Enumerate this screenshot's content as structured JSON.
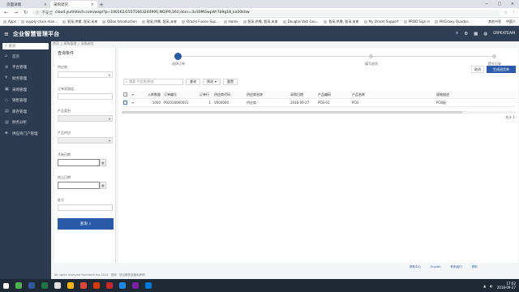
{
  "browser": {
    "tabs": [
      {
        "label": "页面详情",
        "active": false
      },
      {
        "label": "采购退货",
        "active": true
      }
    ],
    "address": "cloud.yunhitech.com/wap/?p=100162/15571663244991;NO/P0,162;docs=3v30MGwpW!7b9g18_ka30ktiw",
    "secure_label": "不安全",
    "bookmarks": [
      "Apps",
      "supply chain man...",
      "智采,供需, 智采,未来",
      "ODoo Introduction",
      "智采,供需, 智采,未来",
      "Oracle Fusion Sup...",
      "Home",
      "智采,供需, 智采,未来",
      "Douglas Valz Gou...",
      "",
      "智采,供需, 智采,未来",
      "My Oracle Support",
      "PROD Sign in",
      "McGrawy Quarter..."
    ],
    "bookmarks_right": [
      "其他书签",
      "中国人"
    ]
  },
  "app": {
    "title": "企业智慧管理平台",
    "user": "ERPEATEAM"
  },
  "sidebar": {
    "search_placeholder": "搜索",
    "items": [
      {
        "label": "首页",
        "icon": "home-icon"
      },
      {
        "label": "平台管理",
        "icon": "settings-icon"
      },
      {
        "label": "财务管理",
        "icon": "finance-icon"
      },
      {
        "label": "采购管理",
        "icon": "cart-icon"
      },
      {
        "label": "销售管理",
        "icon": "sales-icon"
      },
      {
        "label": "库存管理",
        "icon": "inventory-icon"
      },
      {
        "label": "财务分析",
        "icon": "chart-icon"
      },
      {
        "label": "供应商门户管理",
        "icon": "portal-icon"
      }
    ]
  },
  "breadcrumb": [
    "首页",
    "采购管理",
    "采购退货"
  ],
  "filter": {
    "title": "查询条件",
    "fields": [
      {
        "label": "供应商",
        "type": "select"
      },
      {
        "label": "订单采购组",
        "type": "text"
      },
      {
        "label": "产品类别",
        "type": "select-grey"
      },
      {
        "label": "产品供应",
        "type": "select-grey"
      },
      {
        "label": "开始日期",
        "type": "date"
      },
      {
        "label": "终止日期",
        "type": "date"
      },
      {
        "label": "批号",
        "type": "text"
      }
    ],
    "query_label": "查询"
  },
  "steps": [
    {
      "label": "选择订单",
      "active": true
    },
    {
      "label": "填写退货",
      "active": false
    },
    {
      "label": "提交记录",
      "active": false
    }
  ],
  "actions": {
    "cancel": "取消",
    "next": "生成退货单"
  },
  "toolbar": {
    "search_placeholder": "搜索 产品名/供应",
    "search_btn": "查询",
    "filter_btn": "筛选",
    "reset_btn": "重置"
  },
  "table": {
    "columns": [
      "",
      "",
      "入库数量",
      "订单编号",
      "订单行",
      "供应商代码",
      "供应商名称",
      "采购日期",
      "产品编码",
      "产品名称",
      "规格描述"
    ],
    "rows": [
      [
        "",
        "",
        "1000",
        "P02016000001",
        "1",
        "V000000",
        "供应商",
        "2018-09-27",
        "PCB-01",
        "PCB",
        "PCB板"
      ]
    ],
    "total": "合计 1"
  },
  "footer": {
    "copyright": "All rights reserved.Yunhitech.Inc.2014 · 官网 · 协议服务及隐私声明",
    "links": [
      "帮助中心",
      "English",
      "联系我们",
      "帮助"
    ]
  },
  "taskbar": {
    "time": "17:02",
    "date": "2018-09-27"
  }
}
